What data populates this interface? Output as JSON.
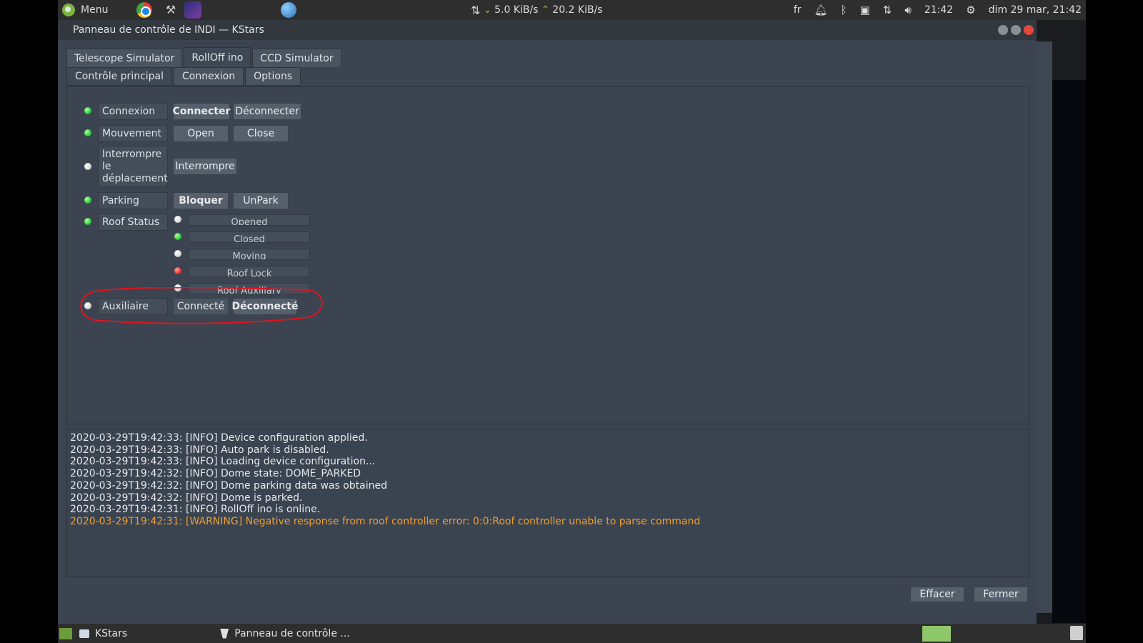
{
  "top_panel": {
    "menu_label": "Menu",
    "net_down": "5.0 KiB/s",
    "net_up": "20.2 KiB/s",
    "keyboard_layout": "fr",
    "clock": "21:42",
    "date_time": "dim 29 mar, 21:42"
  },
  "window": {
    "title": "Panneau de contrôle de INDI — KStars"
  },
  "device_tabs": [
    "Telescope Simulator",
    "RollOff ino",
    "CCD Simulator"
  ],
  "group_tabs": [
    "Contrôle principal",
    "Connexion",
    "Options"
  ],
  "properties": {
    "connection": {
      "label": "Connexion",
      "btn1": "Connecter",
      "btn2": "Déconnecter",
      "state": "green"
    },
    "motion": {
      "label": "Mouvement",
      "btn1": "Open",
      "btn2": "Close",
      "state": "green"
    },
    "abort": {
      "label_line1": "Interrompre",
      "label_line2": "le",
      "label_line3": "déplacement",
      "btn1": "Interrompre",
      "state": "white"
    },
    "parking": {
      "label": "Parking",
      "btn1": "Bloquer",
      "btn2": "UnPark",
      "state": "green"
    },
    "roof_status": {
      "label": "Roof Status",
      "state": "green",
      "items": [
        {
          "name": "Opened",
          "state": "white"
        },
        {
          "name": "Closed",
          "state": "green"
        },
        {
          "name": "Moving",
          "state": "white"
        },
        {
          "name": "Roof Lock",
          "state": "red"
        },
        {
          "name": "Roof Auxiliary",
          "state": "white"
        }
      ]
    },
    "auxiliary": {
      "label": "Auxiliaire",
      "btn1": "Connecté",
      "btn2": "Déconnecté",
      "state": "white"
    }
  },
  "log": [
    {
      "text": "2020-03-29T19:42:33: [INFO] Device configuration applied.",
      "level": "info"
    },
    {
      "text": "2020-03-29T19:42:33: [INFO] Auto park is disabled.",
      "level": "info"
    },
    {
      "text": "2020-03-29T19:42:33: [INFO] Loading device configuration...",
      "level": "info"
    },
    {
      "text": "2020-03-29T19:42:32: [INFO] Dome state: DOME_PARKED",
      "level": "info"
    },
    {
      "text": "2020-03-29T19:42:32: [INFO] Dome parking data was obtained",
      "level": "info"
    },
    {
      "text": "2020-03-29T19:42:32: [INFO] Dome is parked.",
      "level": "info"
    },
    {
      "text": "2020-03-29T19:42:31: [INFO] RollOff ino is online.",
      "level": "info"
    },
    {
      "text": "2020-03-29T19:42:31: [WARNING] Negative response from roof controller error: 0:0:Roof controller unable to parse command",
      "level": "warning"
    }
  ],
  "footer": {
    "clear": "Effacer",
    "close": "Fermer"
  },
  "taskbar": {
    "app1": "KStars",
    "app2": "Panneau de contrôle ..."
  },
  "colors": {
    "led_green": "#2ecc40",
    "led_red": "#e53935",
    "warning_text": "#f0a030",
    "annotation": "#e0141e"
  }
}
